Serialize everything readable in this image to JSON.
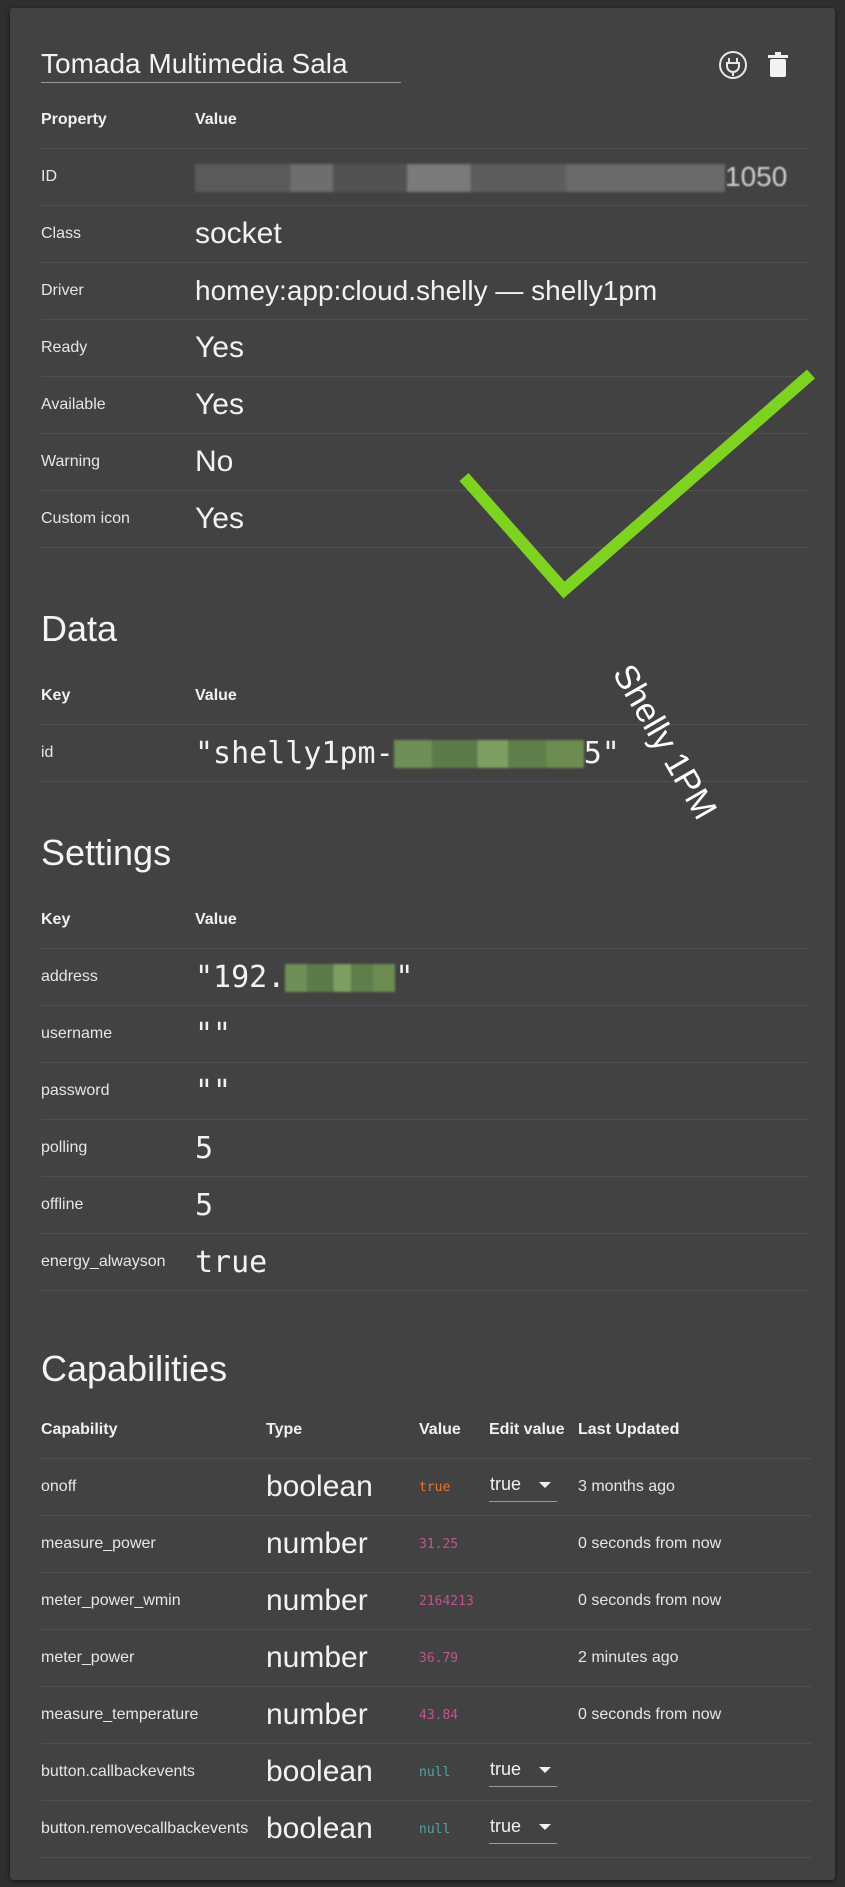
{
  "header": {
    "title": "Tomada Multimedia Sala",
    "icons": [
      "plug-icon",
      "trash-icon"
    ]
  },
  "properties": {
    "col_property": "Property",
    "col_value": "Value",
    "rows": [
      {
        "key": "ID",
        "value": "1050"
      },
      {
        "key": "Class",
        "value": "socket"
      },
      {
        "key": "Driver",
        "value": "homey:app:cloud.shelly — shelly1pm"
      },
      {
        "key": "Ready",
        "value": "Yes"
      },
      {
        "key": "Available",
        "value": "Yes"
      },
      {
        "key": "Warning",
        "value": "No"
      },
      {
        "key": "Custom icon",
        "value": "Yes"
      }
    ]
  },
  "data_section": {
    "title": "Data",
    "col_key": "Key",
    "col_value": "Value",
    "rows": [
      {
        "key": "id",
        "value_prefix": "\"shelly1pm-",
        "value_suffix": "5\""
      }
    ]
  },
  "settings": {
    "title": "Settings",
    "col_key": "Key",
    "col_value": "Value",
    "rows": [
      {
        "key": "address",
        "value_prefix": "\"192.",
        "value_suffix": "\""
      },
      {
        "key": "username",
        "value": "\"\""
      },
      {
        "key": "password",
        "value": "\"\""
      },
      {
        "key": "polling",
        "value": "5"
      },
      {
        "key": "offline",
        "value": "5"
      },
      {
        "key": "energy_alwayson",
        "value": "true"
      }
    ]
  },
  "capabilities": {
    "title": "Capabilities",
    "columns": [
      "Capability",
      "Type",
      "Value",
      "Edit value",
      "Last Updated"
    ],
    "rows": [
      {
        "capability": "onoff",
        "type": "boolean",
        "value": "true",
        "edit": "true",
        "updated": "3 months ago"
      },
      {
        "capability": "measure_power",
        "type": "number",
        "value": "31.25",
        "edit": "",
        "updated": "0 seconds from now"
      },
      {
        "capability": "meter_power_wmin",
        "type": "number",
        "value": "2164213",
        "edit": "",
        "updated": "0 seconds from now"
      },
      {
        "capability": "meter_power",
        "type": "number",
        "value": "36.79",
        "edit": "",
        "updated": "2 minutes ago"
      },
      {
        "capability": "measure_temperature",
        "type": "number",
        "value": "43.84",
        "edit": "",
        "updated": "0 seconds from now"
      },
      {
        "capability": "button.callbackevents",
        "type": "boolean",
        "value": "null",
        "edit": "true",
        "updated": ""
      },
      {
        "capability": "button.removecallbackevents",
        "type": "boolean",
        "value": "null",
        "edit": "true",
        "updated": ""
      }
    ]
  },
  "annotation": {
    "label": "Shelly 1PM",
    "check_color": "#7ed321"
  },
  "colors": {
    "string": "#8bc34a",
    "number": "#c2548d",
    "boolean": "#e8742e",
    "null": "#4fa3a8"
  }
}
